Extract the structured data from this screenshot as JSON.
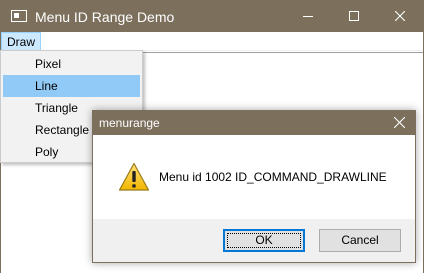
{
  "window": {
    "title": "Menu ID Range Demo",
    "icon": "app-window-icon",
    "controls": [
      "minimize-icon",
      "maximize-icon",
      "close-icon"
    ]
  },
  "menubar": {
    "draw_label": "Draw"
  },
  "draw_menu": {
    "items": [
      {
        "label": "Pixel",
        "highlighted": false
      },
      {
        "label": "Line",
        "highlighted": true
      },
      {
        "label": "Triangle",
        "highlighted": false
      },
      {
        "label": "Rectangle",
        "highlighted": false
      },
      {
        "label": "Poly",
        "highlighted": false
      }
    ],
    "highlight_color": "#91c9f7"
  },
  "dialog": {
    "title": "menurange",
    "icon": "warning-icon",
    "message": "Menu id 1002 ID_COMMAND_DRAWLINE",
    "ok_label": "OK",
    "cancel_label": "Cancel"
  },
  "colors": {
    "titlebar": "#7c6f5c",
    "accent": "#0078d7",
    "menu_hover": "#cce8ff"
  }
}
